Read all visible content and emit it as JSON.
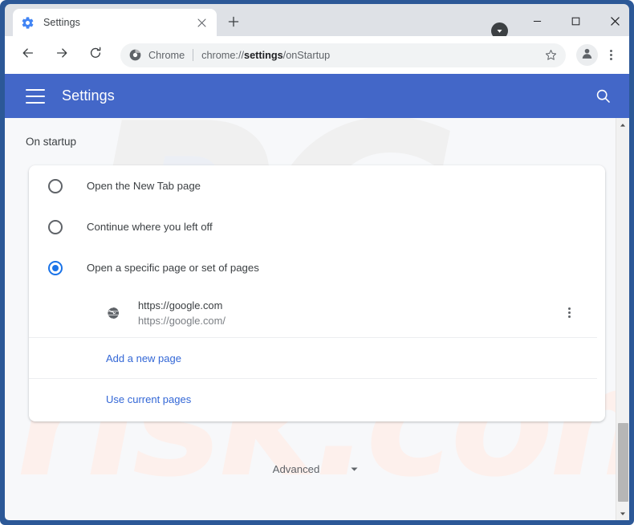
{
  "window": {
    "frame_color": "#2c5897",
    "controls": {
      "minimize_icon": "minimize-icon",
      "maximize_icon": "maximize-icon",
      "close_icon": "close-icon"
    }
  },
  "tabstrip": {
    "tabs": [
      {
        "title": "Settings",
        "favicon": "gear-icon",
        "active": true,
        "close_icon": "close-icon"
      }
    ],
    "new_tab_icon": "plus-icon",
    "download_indicator_icon": "download-arrow-icon"
  },
  "toolbar": {
    "back_icon": "arrow-left-icon",
    "forward_icon": "arrow-right-icon",
    "reload_icon": "reload-icon",
    "omnibox": {
      "brand_icon": "chrome-logo-icon",
      "brand_label": "Chrome",
      "url_prefix": "chrome://",
      "url_bold": "settings",
      "url_suffix": "/onStartup",
      "full_url": "chrome://settings/onStartup"
    },
    "bookmark_icon": "star-icon",
    "profile_icon": "person-icon",
    "menu_icon": "kebab-menu-icon"
  },
  "settings_header": {
    "menu_icon": "hamburger-icon",
    "title": "Settings",
    "search_icon": "search-icon",
    "background_color": "#4367c8"
  },
  "watermark": {
    "logo_text": "PC",
    "domain_text": "risk.com"
  },
  "main": {
    "section_title": "On startup",
    "startup_options": [
      {
        "label": "Open the New Tab page",
        "selected": false
      },
      {
        "label": "Continue where you left off",
        "selected": false
      },
      {
        "label": "Open a specific page or set of pages",
        "selected": true
      }
    ],
    "startup_pages": [
      {
        "favicon": "globe-icon",
        "title": "https://google.com",
        "url": "https://google.com/",
        "menu_icon": "kebab-menu-icon"
      }
    ],
    "add_page_link": "Add a new page",
    "use_current_pages_link": "Use current pages",
    "advanced": {
      "label": "Advanced",
      "chevron_icon": "chevron-down-icon"
    },
    "accent_color": "#1a73e8",
    "link_color": "#3367d6"
  },
  "scrollbar": {
    "up_arrow_icon": "caret-up-icon",
    "down_arrow_icon": "caret-down-icon"
  }
}
